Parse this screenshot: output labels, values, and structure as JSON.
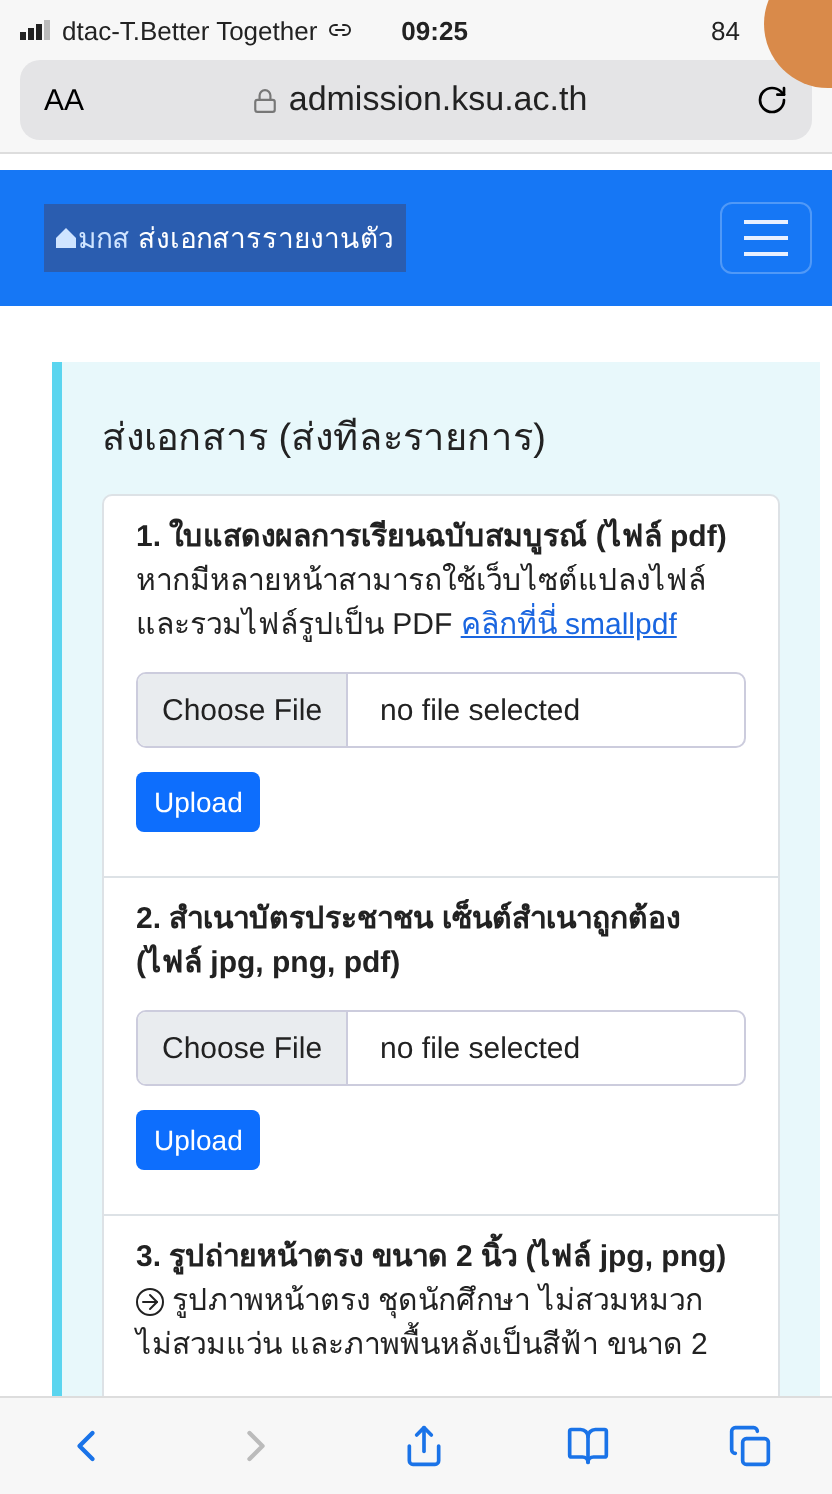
{
  "status_bar": {
    "carrier": "dtac-T.Better Together",
    "time": "09:25",
    "battery": "84"
  },
  "address_bar": {
    "text_size": "AA",
    "url": "admission.ksu.ac.th"
  },
  "navbar": {
    "logo": "มกส",
    "title": "ส่งเอกสารรายงานตัว"
  },
  "panel": {
    "heading": "ส่งเอกสาร (ส่งทีละรายการ)"
  },
  "items": [
    {
      "title": "1. ใบแสดงผลการเรียนฉบับสมบูรณ์ (ไฟล์ pdf)",
      "description": "หากมีหลายหน้าสามารถใช้เว็บไซต์แปลงไฟล์และรวมไฟล์รูปเป็น PDF",
      "link": "คลิกที่นี่ smallpdf",
      "file_button": "Choose File",
      "file_status": "no file selected",
      "upload": "Upload"
    },
    {
      "title": "2. สำเนาบัตรประชาชน เซ็นต์สำเนาถูกต้อง (ไฟล์ jpg, png, pdf)",
      "file_button": "Choose File",
      "file_status": "no file selected",
      "upload": "Upload"
    },
    {
      "title": "3. รูปถ่ายหน้าตรง ขนาด 2 นิ้ว (ไฟล์ jpg, png)",
      "note": "รูปภาพหน้าตรง ชุดนักศึกษา ไม่สวมหมวก ไม่สวมแว่น และภาพพื้นหลังเป็นสีฟ้า ขนาด 2"
    }
  ]
}
